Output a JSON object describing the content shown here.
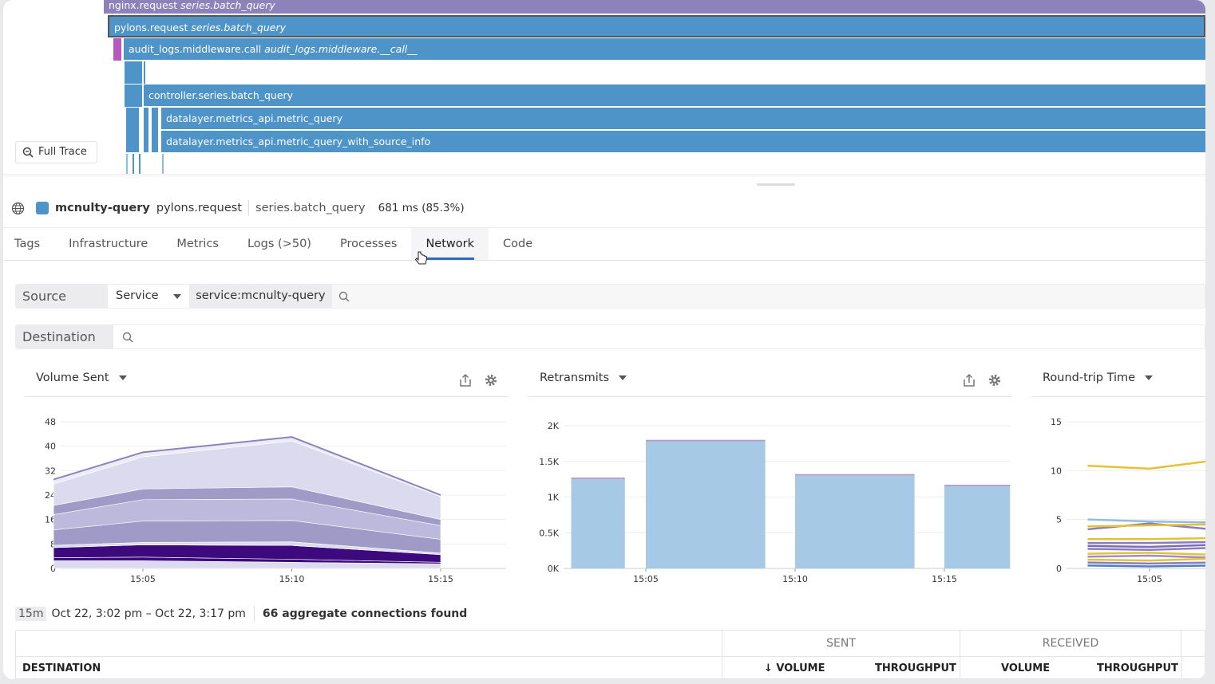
{
  "flame": {
    "spans": [
      {
        "name": "nginx.request",
        "resource": "series.batch_query",
        "color": "#8e82bb"
      },
      {
        "name": "pylons.request",
        "resource": "series.batch_query",
        "color": "#4f94c8"
      },
      {
        "name": "audit_logs.middleware.call",
        "resource": "audit_logs.middleware.__call__",
        "color": "#4f94c8"
      },
      {
        "name": "controller.series.batch_query",
        "resource": "",
        "color": "#4f94c8"
      },
      {
        "name": "datalayer.metrics_api.metric_query",
        "resource": "",
        "color": "#4f94c8"
      },
      {
        "name": "datalayer.metrics_api.metric_query_with_source_info",
        "resource": "",
        "color": "#4f94c8"
      }
    ],
    "full_trace_label": "Full Trace"
  },
  "span_header": {
    "service": "mcnulty-query",
    "operation": "pylons.request",
    "resource": "series.batch_query",
    "duration": "681 ms (85.3%)",
    "service_color": "#4f94c8"
  },
  "tabs": [
    {
      "label": "Tags"
    },
    {
      "label": "Infrastructure"
    },
    {
      "label": "Metrics"
    },
    {
      "label": "Logs (>50)"
    },
    {
      "label": "Processes"
    },
    {
      "label": "Network",
      "active": true
    },
    {
      "label": "Code"
    }
  ],
  "filters": {
    "source_label": "Source",
    "source_type": "Service",
    "source_tag": "service:mcnulty-query",
    "destination_label": "Destination"
  },
  "widgets": [
    {
      "title": "Volume Sent"
    },
    {
      "title": "Retransmits"
    },
    {
      "title": "Round-trip Time"
    }
  ],
  "chart_data": [
    {
      "type": "area",
      "title": "Volume Sent",
      "x": [
        "15:02",
        "15:05",
        "15:10",
        "15:15"
      ],
      "yticks": [
        "0",
        "8",
        "16",
        "24",
        "32",
        "40",
        "48"
      ],
      "ylim": [
        0,
        48
      ],
      "xticks": [
        "15:05",
        "15:10",
        "15:15"
      ],
      "series": [
        {
          "values": [
            2.5,
            2.5,
            2,
            1.5
          ],
          "color": "#dcdaee"
        },
        {
          "values": [
            1,
            1.2,
            1,
            0.5
          ],
          "color": "#3b0a7a"
        },
        {
          "values": [
            3.3,
            4,
            4.5,
            2.5
          ],
          "color": "#3d0a7e"
        },
        {
          "values": [
            0.8,
            0.8,
            1.2,
            0.5
          ],
          "color": "#dcdaee"
        },
        {
          "values": [
            5,
            7,
            7,
            4.5
          ],
          "color": "#9f9ac6"
        },
        {
          "values": [
            5,
            7,
            7,
            4.5
          ],
          "color": "#bcb9dc"
        },
        {
          "values": [
            3,
            3.5,
            4,
            2
          ],
          "color": "#9f9ac6"
        },
        {
          "values": [
            7,
            10.5,
            15,
            7.5
          ],
          "color": "#dcdaee"
        },
        {
          "values": [
            1.5,
            1.5,
            1.3,
            0.5
          ],
          "color": "#ecebf6"
        }
      ]
    },
    {
      "type": "bar",
      "title": "Retransmits",
      "yticks": [
        "0K",
        "0.5K",
        "1K",
        "1.5K",
        "2K"
      ],
      "ylim": [
        0,
        2000
      ],
      "xticks": [
        "15:05",
        "15:10",
        "15:15"
      ],
      "bars": [
        {
          "start": "15:02.5",
          "end": "15:04.3",
          "value": 1250
        },
        {
          "start": "15:05",
          "end": "15:09",
          "value": 1780
        },
        {
          "start": "15:10",
          "end": "15:14",
          "value": 1300
        },
        {
          "start": "15:15",
          "end": "15:17.2",
          "value": 1150
        }
      ],
      "color": "#a6cae6"
    },
    {
      "type": "line",
      "title": "Round-trip Time",
      "x": [
        "15:02.5",
        "15:05",
        "15:07.5"
      ],
      "yticks": [
        "0",
        "5",
        "10",
        "15"
      ],
      "ylim": [
        0,
        15
      ],
      "xticks": [
        "15:05"
      ],
      "series": [
        {
          "values": [
            10.5,
            10.2,
            11
          ],
          "color": "#e5c234"
        },
        {
          "values": [
            5,
            4.8,
            4.7
          ],
          "color": "#92bde0"
        },
        {
          "values": [
            4,
            4.6,
            4
          ],
          "color": "#8a7cc0"
        },
        {
          "values": [
            4.3,
            4.4,
            4.5
          ],
          "color": "#e5c234"
        },
        {
          "values": [
            3,
            3,
            3.1
          ],
          "color": "#e5c234"
        },
        {
          "values": [
            2.6,
            2.6,
            2.7
          ],
          "color": "#8a7cc0"
        },
        {
          "values": [
            2.3,
            2.2,
            2.4
          ],
          "color": "#7a6cb8"
        },
        {
          "values": [
            2,
            1.9,
            2.1
          ],
          "color": "#8a7cc0"
        },
        {
          "values": [
            1.5,
            1.6,
            1.4
          ],
          "color": "#e5c234"
        },
        {
          "values": [
            1.2,
            1.3,
            1.1
          ],
          "color": "#9c8ecc"
        },
        {
          "values": [
            0.9,
            0.8,
            1
          ],
          "color": "#e5c234"
        },
        {
          "values": [
            0.6,
            0.5,
            0.6
          ],
          "color": "#8a7cc0"
        },
        {
          "values": [
            0.3,
            0.2,
            0.3
          ],
          "color": "#4f7fc0"
        }
      ]
    }
  ],
  "footer": {
    "range_badge": "15m",
    "range": "Oct 22, 3:02 pm – Oct 22, 3:17 pm",
    "count": "66 aggregate connections found"
  },
  "table": {
    "group_sent": "SENT",
    "group_received": "RECEIVED",
    "columns": [
      "DESTINATION",
      "↓ VOLUME",
      "THROUGHPUT",
      "VOLUME",
      "THROUGHPUT"
    ]
  }
}
